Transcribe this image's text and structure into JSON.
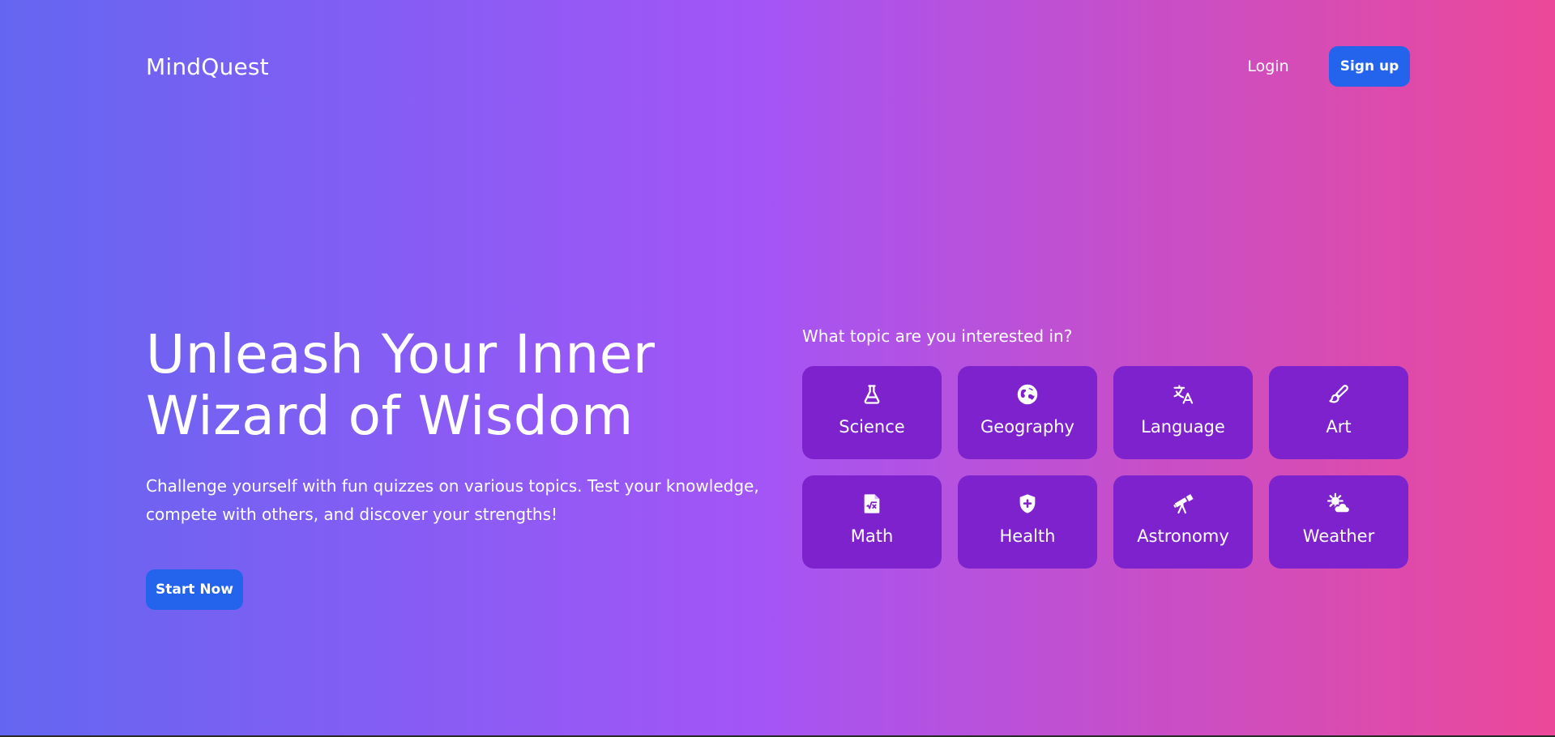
{
  "header": {
    "brand": "MindQuest",
    "login_label": "Login",
    "signup_label": "Sign up"
  },
  "hero": {
    "title_line1": "Unleash Your Inner",
    "title_line2": "Wizard of Wisdom",
    "subtitle": "Challenge yourself with fun quizzes on various topics. Test your knowledge, compete with others, and discover your strengths!",
    "start_label": "Start Now"
  },
  "topics": {
    "prompt": "What topic are you interested in?",
    "items": [
      {
        "label": "Science",
        "icon": "flask-icon"
      },
      {
        "label": "Geography",
        "icon": "globe-icon"
      },
      {
        "label": "Language",
        "icon": "translate-icon"
      },
      {
        "label": "Art",
        "icon": "paintbrush-icon"
      },
      {
        "label": "Math",
        "icon": "math-document-icon"
      },
      {
        "label": "Health",
        "icon": "shield-plus-icon"
      },
      {
        "label": "Astronomy",
        "icon": "telescope-icon"
      },
      {
        "label": "Weather",
        "icon": "sun-cloud-icon"
      }
    ]
  },
  "colors": {
    "gradient_start": "#6466f1",
    "gradient_mid": "#a355f7",
    "gradient_end": "#ec4899",
    "button_blue": "#2463eb",
    "card_purple": "#7e22ce"
  }
}
